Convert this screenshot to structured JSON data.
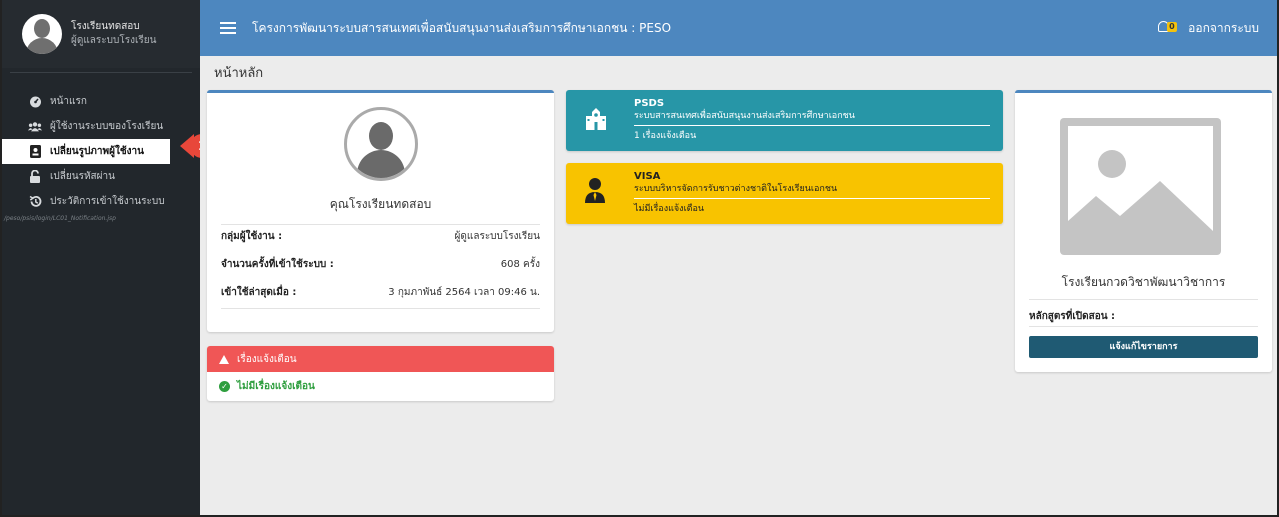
{
  "sidebar": {
    "user_name": "โรงเรียนทดสอบ",
    "user_role": "ผู้ดูแลระบบโรงเรียน",
    "items": [
      {
        "label": "หน้าแรก",
        "icon": "dashboard-icon"
      },
      {
        "label": "ผู้ใช้งานระบบของโรงเรียน",
        "icon": "users-icon"
      },
      {
        "label": "เปลี่ยนรูปภาพผู้ใช้งาน",
        "icon": "id-card-icon"
      },
      {
        "label": "เปลี่ยนรหัสผ่าน",
        "icon": "unlock-icon"
      },
      {
        "label": "ประวัติการเข้าใช้งานระบบ",
        "icon": "history-icon"
      }
    ],
    "path_text": "/peso/psis/login/LC01_Notification.jsp",
    "step_badge": "1"
  },
  "header": {
    "title": "โครงการพัฒนาระบบสารสนเทศเพื่อสนับสนุนงานส่งเสริมการศึกษาเอกชน : PESO",
    "notification_count": "0",
    "logout_label": "ออกจากระบบ"
  },
  "page_title": "หน้าหลัก",
  "profile": {
    "name": "คุณโรงเรียนทดสอบ",
    "rows": [
      {
        "label": "กลุ่มผู้ใช้งาน :",
        "value": "ผู้ดูแลระบบโรงเรียน"
      },
      {
        "label": "จำนวนครั้งที่เข้าใช้ระบบ :",
        "value": "608  ครั้ง"
      },
      {
        "label": "เข้าใช้ล่าสุดเมื่อ :",
        "value": "3 กุมภาพันธ์ 2564 เวลา 09:46 น."
      }
    ]
  },
  "alerts": {
    "title": "เรื่องแจ้งเตือน",
    "message": "ไม่มีเรื่องแจ้งเตือน"
  },
  "systems": [
    {
      "name": "PSDS",
      "desc": "ระบบสารสนเทศเพื่อสนับสนุนงานส่งเสริมการศึกษาเอกชน",
      "note": "1 เรื่องแจ้งเตือน",
      "color": "#2796a7"
    },
    {
      "name": "VISA",
      "desc": "ระบบบริหารจัดการรับชาวต่างชาติในโรงเรียนเอกชน",
      "note": "ไม่มีเรื่องแจ้งเตือน",
      "color": "#f8c300"
    }
  ],
  "school": {
    "name": "โรงเรียนกวดวิชาพัฒนาวิชาการ",
    "course_label": "หลักสูตรที่เปิดสอน :",
    "button_label": "แจ้งแก้ไขรายการ"
  },
  "colors": {
    "header": "#4d87bf",
    "sidebar": "#22272c",
    "alert": "#f05656",
    "button": "#1f5a73"
  }
}
